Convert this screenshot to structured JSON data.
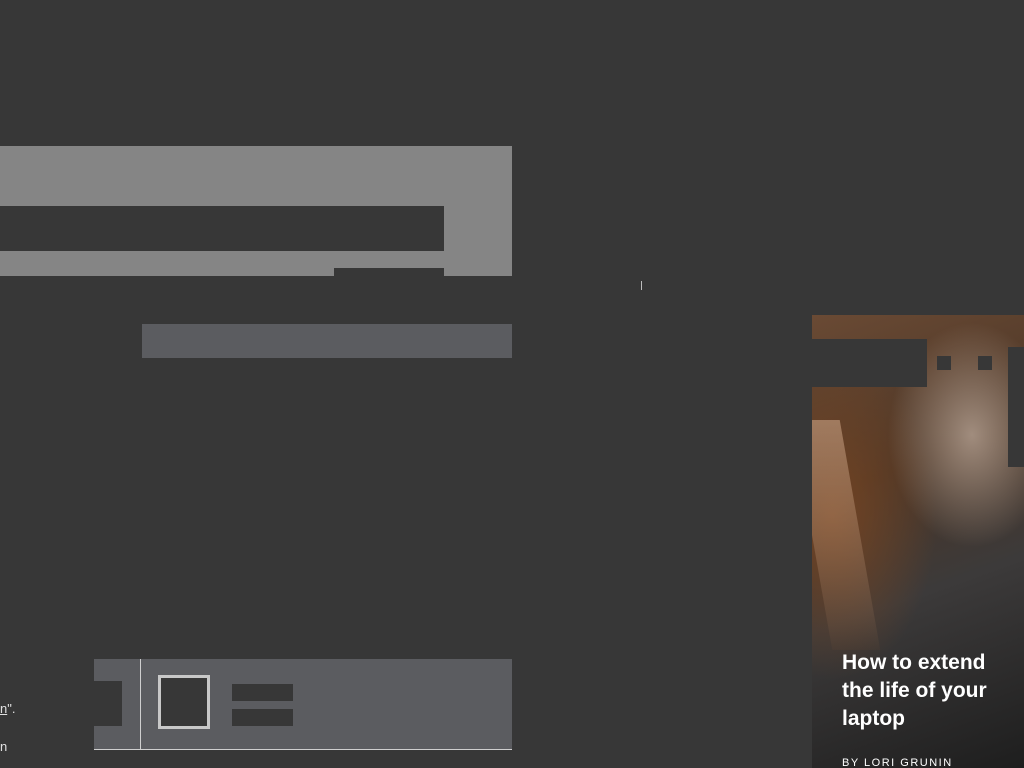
{
  "left_fragments": {
    "line1_underlined": "n",
    "line1_rest": "\".",
    "line2": "n"
  },
  "promo": {
    "title": "How to extend the life of your laptop",
    "byline": "BY LORI GRUNIN"
  },
  "colors": {
    "page_background": "#373737",
    "banner": "#858585",
    "card": "#5b5c60"
  }
}
